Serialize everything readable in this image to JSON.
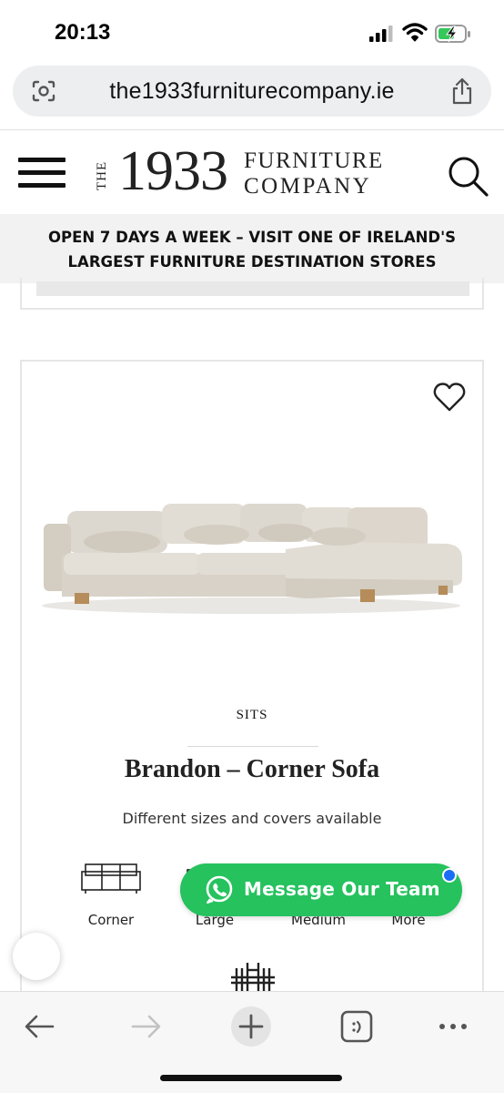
{
  "status_bar": {
    "time": "20:13"
  },
  "browser": {
    "url": "the1933furniturecompany.ie"
  },
  "site": {
    "logo": {
      "the": "THE",
      "year": "1933",
      "word1": "FURNITURE",
      "word2": "COMPANY"
    },
    "announcement_line1": "OPEN 7 DAYS A WEEK – VISIT ONE OF IRELAND'S",
    "announcement_line2": "LARGEST FURNITURE DESTINATION STORES"
  },
  "product": {
    "brand": "SITS",
    "title": "Brandon – Corner Sofa",
    "subtitle": "Different sizes and covers available",
    "sizes": [
      {
        "label": "Corner",
        "icon": "corner-sofa-icon"
      },
      {
        "label": "Large",
        "icon": "large-sofa-icon"
      },
      {
        "label": "Medium",
        "icon": "medium-sofa-icon"
      }
    ],
    "more_label": "More"
  },
  "whatsapp": {
    "label": "Message Our Team",
    "color": "#25c25e"
  },
  "colors": {
    "announcement_bg": "#f2f2f2",
    "whatsapp_green": "#25c25e",
    "notification_blue": "#1a6ef5"
  }
}
